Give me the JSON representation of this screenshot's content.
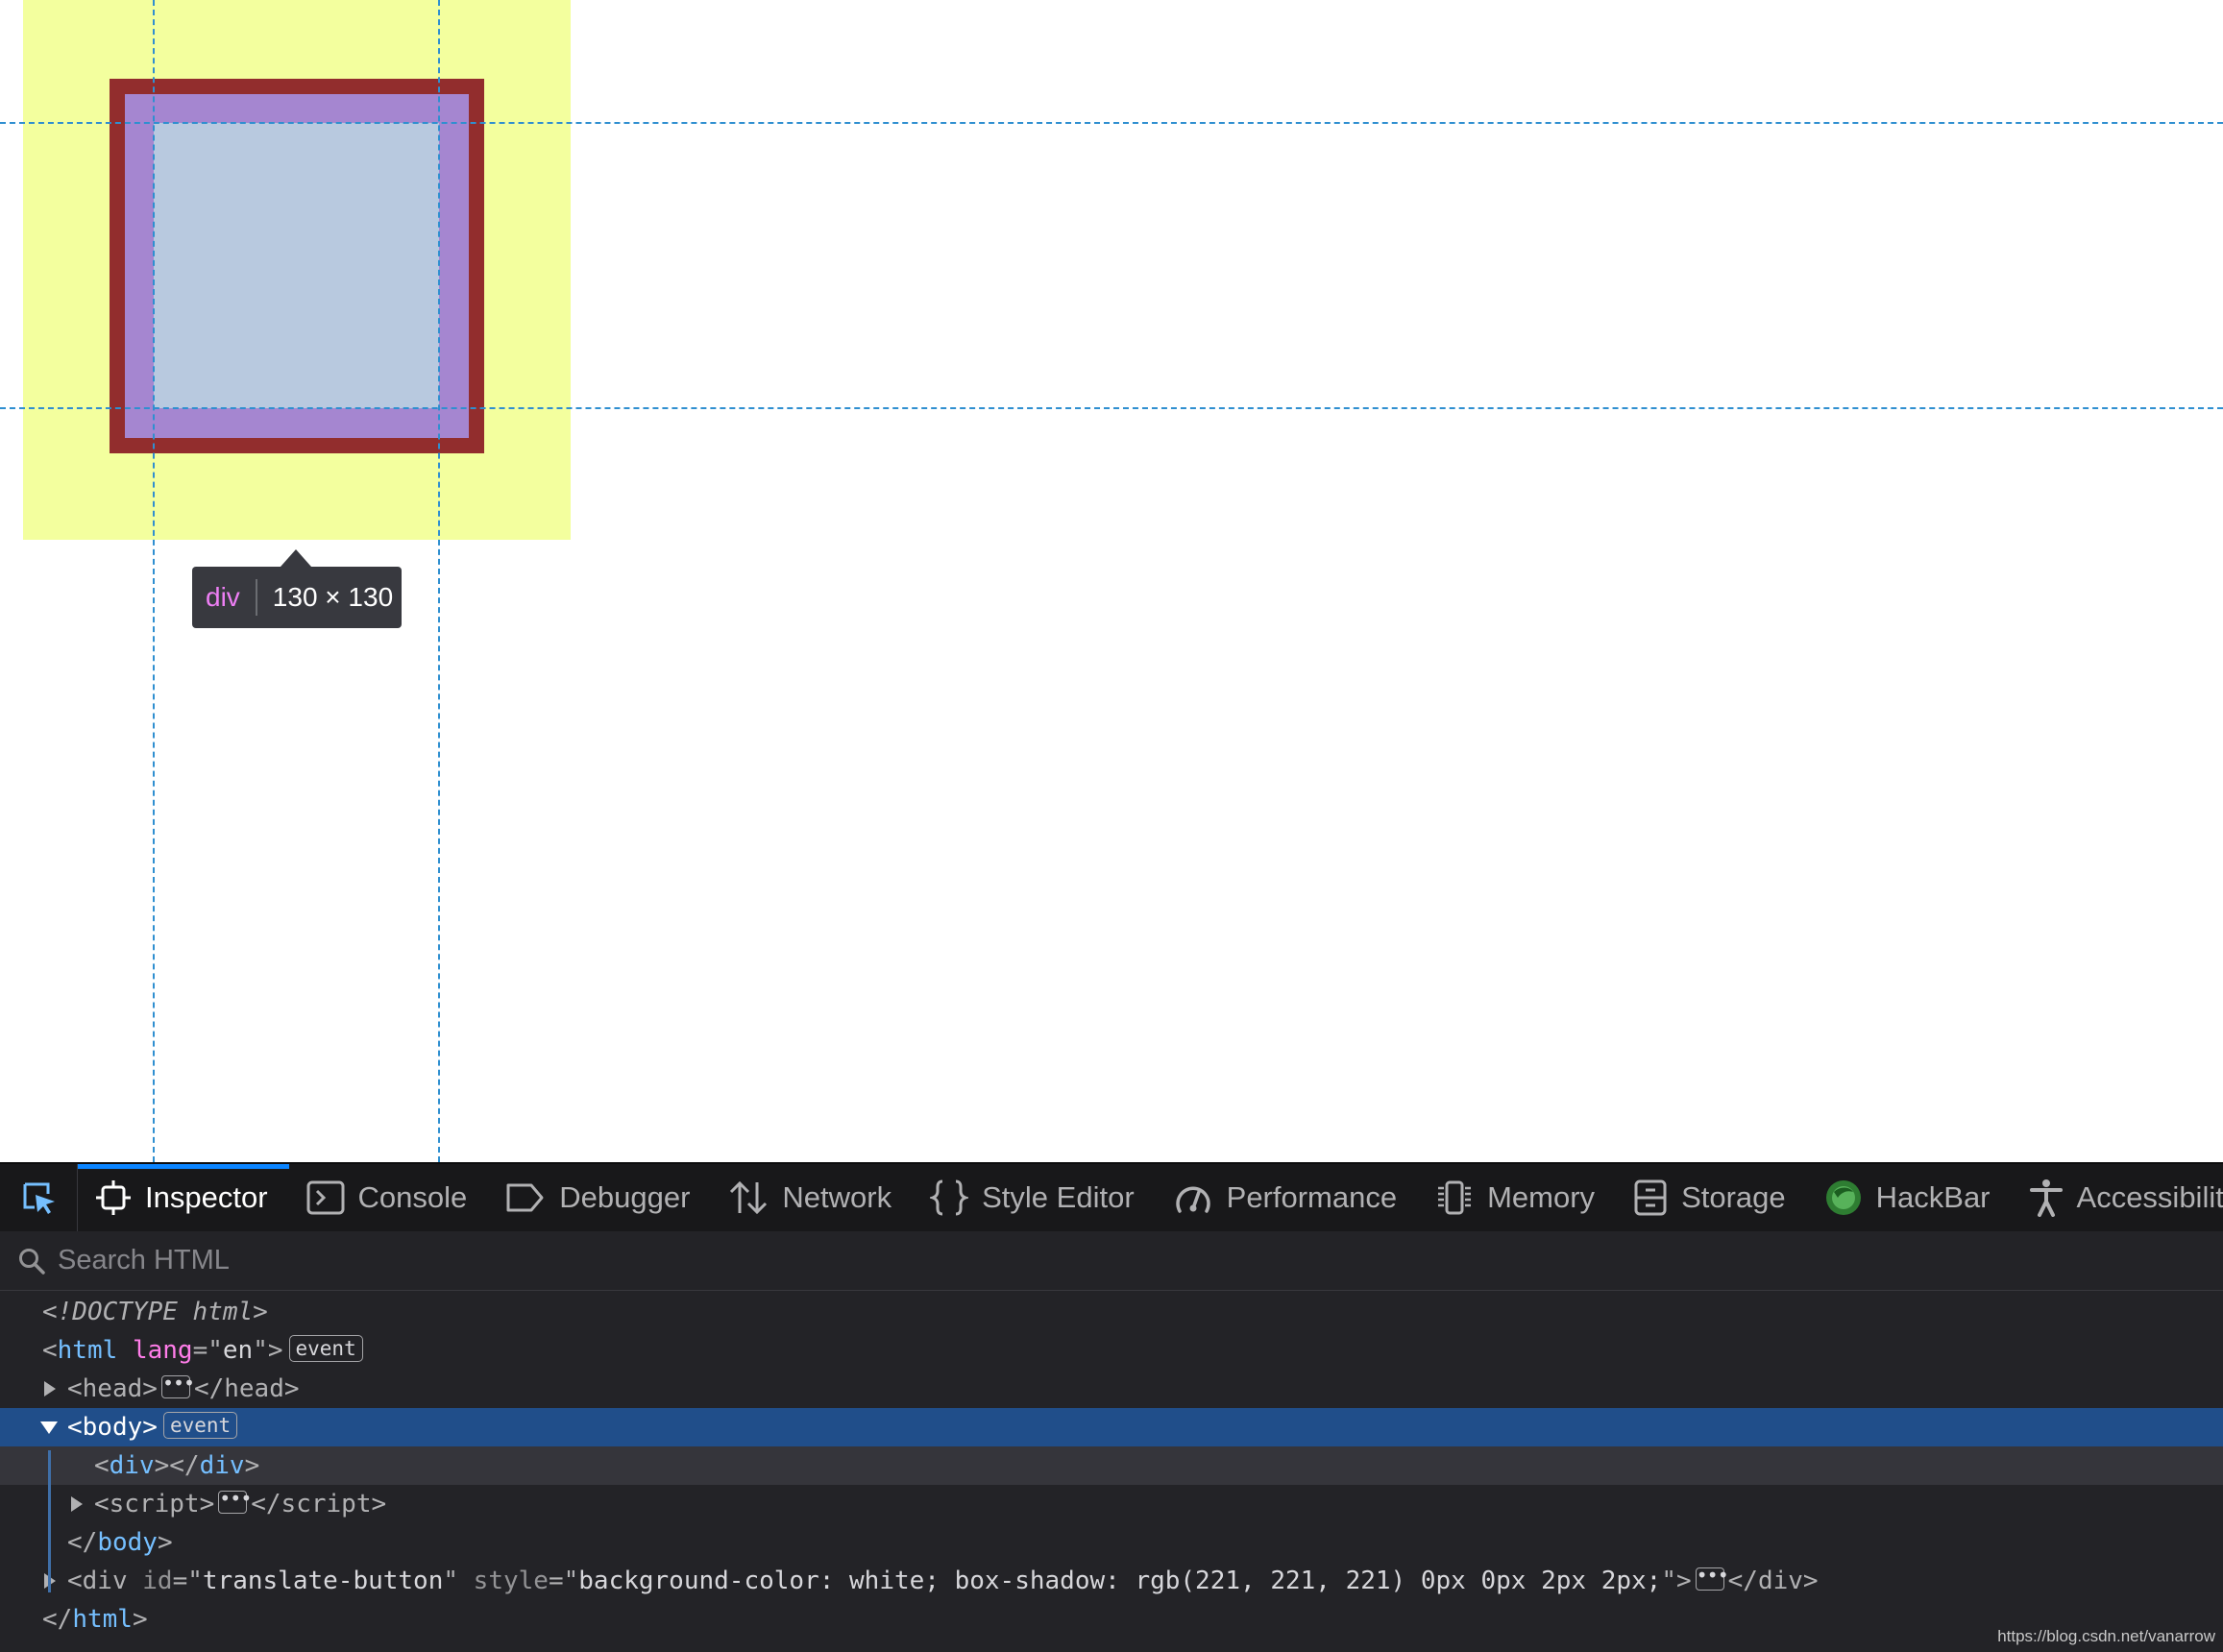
{
  "highlighter": {
    "tag": "div",
    "dimensions": "130 × 130",
    "colors": {
      "margin": "#f3ff9e",
      "border": "#922d2d",
      "padding": "#a586d0",
      "content": "#b8c9df",
      "guides": "#2f8fd0"
    }
  },
  "toolbar": {
    "picker_icon": "element-picker-icon",
    "tabs": [
      {
        "label": "Inspector",
        "icon": "inspector-icon",
        "selected": true
      },
      {
        "label": "Console",
        "icon": "console-icon"
      },
      {
        "label": "Debugger",
        "icon": "debugger-icon"
      },
      {
        "label": "Network",
        "icon": "network-icon"
      },
      {
        "label": "Style Editor",
        "icon": "style-editor-icon"
      },
      {
        "label": "Performance",
        "icon": "performance-icon"
      },
      {
        "label": "Memory",
        "icon": "memory-icon"
      },
      {
        "label": "Storage",
        "icon": "storage-icon"
      },
      {
        "label": "HackBar",
        "icon": "hackbar-icon"
      },
      {
        "label": "Accessibility",
        "icon": "accessibility-icon"
      }
    ],
    "accent": "#0a84ff"
  },
  "search": {
    "placeholder": "Search HTML",
    "value": ""
  },
  "markup": {
    "doctype": "<!DOCTYPE html>",
    "html_open_tag": "html",
    "html_attr": "lang",
    "html_attr_value": "en",
    "event_badge": "event",
    "head_tag": "head",
    "body_tag": "body",
    "div_tag": "div",
    "script_tag": "script",
    "translate_div_tag": "div",
    "translate_id_attr": "id",
    "translate_id_value": "translate-button",
    "translate_style_attr": "style",
    "translate_style_value": "background-color: white; box-shadow: rgb(221, 221, 221) 0px 0px 2px 2px;",
    "html_close_tag": "html",
    "selected_row_color": "#204e8a"
  },
  "watermark": "https://blog.csdn.net/vanarrow"
}
